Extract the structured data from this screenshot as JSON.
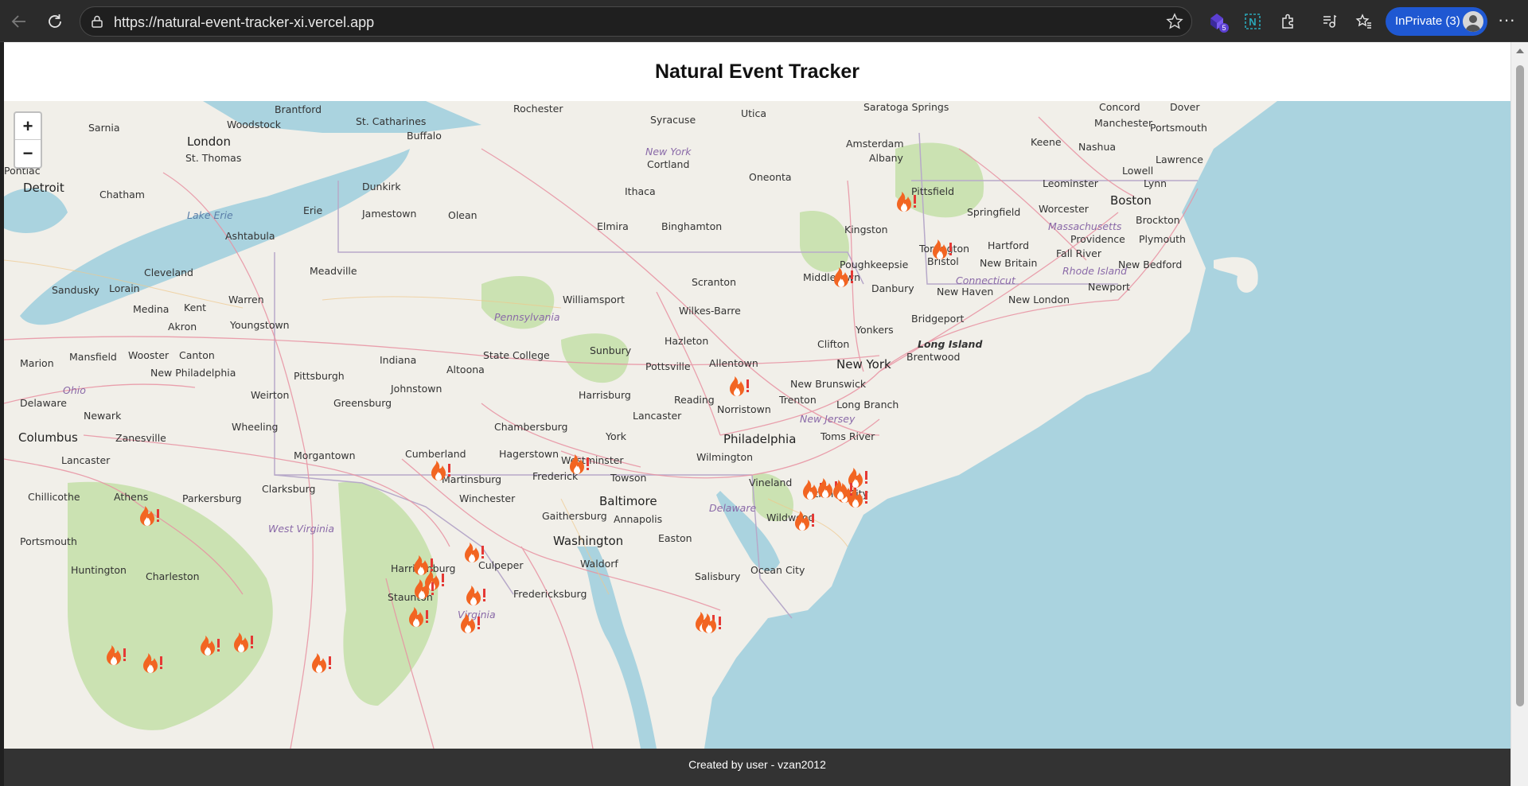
{
  "browser": {
    "url": "https://natural-event-tracker-xi.vercel.app",
    "inprivate_label": "InPrivate (3)",
    "extension_badge": "5",
    "more_label": "···"
  },
  "page": {
    "title": "Natural Event Tracker",
    "footer": "Created by user - vzan2012"
  },
  "map": {
    "zoom_in": "+",
    "zoom_out": "−",
    "marker_icon": "wildfire-icon",
    "places": [
      {
        "name": "Sarnia"
      },
      {
        "name": "London"
      },
      {
        "name": "Woodstock"
      },
      {
        "name": "Brantford"
      },
      {
        "name": "St. Catharines"
      },
      {
        "name": "Rochester"
      },
      {
        "name": "Buffalo"
      },
      {
        "name": "Syracuse"
      },
      {
        "name": "Utica"
      },
      {
        "name": "Saratoga Springs"
      },
      {
        "name": "Amsterdam"
      },
      {
        "name": "Albany"
      },
      {
        "name": "Concord"
      },
      {
        "name": "Dover"
      },
      {
        "name": "Manchester"
      },
      {
        "name": "Portsmouth"
      },
      {
        "name": "Keene"
      },
      {
        "name": "Nashua"
      },
      {
        "name": "Lowell"
      },
      {
        "name": "Lawrence"
      },
      {
        "name": "Lynn"
      },
      {
        "name": "Leominster"
      },
      {
        "name": "Boston"
      },
      {
        "name": "Worcester"
      },
      {
        "name": "Springfield"
      },
      {
        "name": "Pittsfield"
      },
      {
        "name": "Brockton"
      },
      {
        "name": "Providence"
      },
      {
        "name": "Plymouth"
      },
      {
        "name": "Fall River"
      },
      {
        "name": "New Bedford"
      },
      {
        "name": "Pontiac"
      },
      {
        "name": "Detroit"
      },
      {
        "name": "Chatham"
      },
      {
        "name": "St. Thomas"
      },
      {
        "name": "Dunkirk"
      },
      {
        "name": "Erie"
      },
      {
        "name": "Jamestown"
      },
      {
        "name": "Olean"
      },
      {
        "name": "Elmira"
      },
      {
        "name": "Binghamton"
      },
      {
        "name": "Ithaca"
      },
      {
        "name": "Cortland"
      },
      {
        "name": "Oneonta"
      },
      {
        "name": "Kingston"
      },
      {
        "name": "Torrington"
      },
      {
        "name": "Hartford"
      },
      {
        "name": "Bristol"
      },
      {
        "name": "New Britain"
      },
      {
        "name": "Poughkeepsie"
      },
      {
        "name": "Middletown"
      },
      {
        "name": "Danbury"
      },
      {
        "name": "New Haven"
      },
      {
        "name": "New London"
      },
      {
        "name": "Newport"
      },
      {
        "name": "Ashtabula"
      },
      {
        "name": "Cleveland"
      },
      {
        "name": "Sandusky"
      },
      {
        "name": "Lorain"
      },
      {
        "name": "Medina"
      },
      {
        "name": "Kent"
      },
      {
        "name": "Akron"
      },
      {
        "name": "Warren"
      },
      {
        "name": "Youngstown"
      },
      {
        "name": "Meadville"
      },
      {
        "name": "Williamsport"
      },
      {
        "name": "Scranton"
      },
      {
        "name": "Wilkes-Barre"
      },
      {
        "name": "Yonkers"
      },
      {
        "name": "Bridgeport"
      },
      {
        "name": "Clifton"
      },
      {
        "name": "New York"
      },
      {
        "name": "Brentwood"
      },
      {
        "name": "Hazleton"
      },
      {
        "name": "Sunbury"
      },
      {
        "name": "State College"
      },
      {
        "name": "Altoona"
      },
      {
        "name": "Indiana"
      },
      {
        "name": "Pittsburgh"
      },
      {
        "name": "Johnstown"
      },
      {
        "name": "Mansfield"
      },
      {
        "name": "Wooster"
      },
      {
        "name": "Canton"
      },
      {
        "name": "Marion"
      },
      {
        "name": "New Philadelphia"
      },
      {
        "name": "Pottsville"
      },
      {
        "name": "Allentown"
      },
      {
        "name": "New Brunswick"
      },
      {
        "name": "Trenton"
      },
      {
        "name": "Long Branch"
      },
      {
        "name": "Harrisburg"
      },
      {
        "name": "Reading"
      },
      {
        "name": "Norristown"
      },
      {
        "name": "Lancaster"
      },
      {
        "name": "Greensburg"
      },
      {
        "name": "Weirton"
      },
      {
        "name": "Delaware"
      },
      {
        "name": "Newark"
      },
      {
        "name": "Wheeling"
      },
      {
        "name": "Columbus"
      },
      {
        "name": "Zanesville"
      },
      {
        "name": "Chambersburg"
      },
      {
        "name": "York"
      },
      {
        "name": "Philadelphia"
      },
      {
        "name": "Toms River"
      },
      {
        "name": "Morgantown"
      },
      {
        "name": "Cumberland"
      },
      {
        "name": "Hagerstown"
      },
      {
        "name": "Westminster"
      },
      {
        "name": "Wilmington"
      },
      {
        "name": "Vineland"
      },
      {
        "name": "Lancaster"
      },
      {
        "name": "Martinsburg"
      },
      {
        "name": "Frederick"
      },
      {
        "name": "Towson"
      },
      {
        "name": "Atlantic City"
      },
      {
        "name": "Chillicothe"
      },
      {
        "name": "Athens"
      },
      {
        "name": "Parkersburg"
      },
      {
        "name": "Clarksburg"
      },
      {
        "name": "Winchester"
      },
      {
        "name": "Baltimore"
      },
      {
        "name": "Gaithersburg"
      },
      {
        "name": "Annapolis"
      },
      {
        "name": "Wildwood"
      },
      {
        "name": "Portsmouth"
      },
      {
        "name": "Washington"
      },
      {
        "name": "Huntington"
      },
      {
        "name": "Charleston"
      },
      {
        "name": "Harrisonburg"
      },
      {
        "name": "Culpeper"
      },
      {
        "name": "Waldorf"
      },
      {
        "name": "Easton"
      },
      {
        "name": "Salisbury"
      },
      {
        "name": "Ocean City"
      },
      {
        "name": "Staunton"
      },
      {
        "name": "Fredericksburg"
      }
    ],
    "regions": [
      {
        "name": "New York"
      },
      {
        "name": "Pennsylvania"
      },
      {
        "name": "Ohio"
      },
      {
        "name": "New Jersey"
      },
      {
        "name": "Massachusetts"
      },
      {
        "name": "Connecticut"
      },
      {
        "name": "Rhode Island"
      },
      {
        "name": "West Virginia"
      },
      {
        "name": "Virginia"
      },
      {
        "name": "Delaware"
      },
      {
        "name": "Lake Erie"
      },
      {
        "name": "Long Island"
      }
    ]
  }
}
